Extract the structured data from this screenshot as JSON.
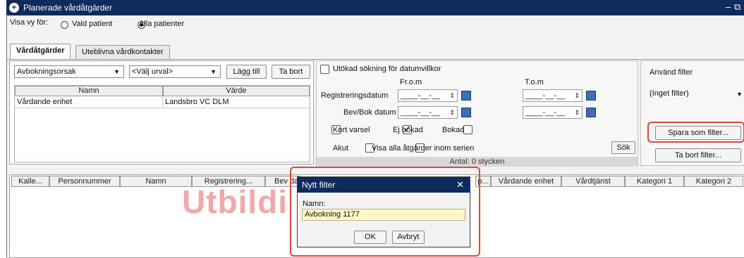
{
  "window": {
    "title": "Planerade vårdåtgärder",
    "minimize_glyph": "–",
    "restore_glyph": "⧉"
  },
  "show_for": {
    "label": "Visa vy för:",
    "options": [
      "Vald patient",
      "Alla patienter"
    ],
    "selected": "Alla patienter"
  },
  "tabs": [
    "Vårdåtgärder",
    "Uteblivna vårdkontakter"
  ],
  "criteria": {
    "reason_select": "Avbokningsorsak",
    "choice_select": "<Välj urval>",
    "add_button": "Lägg till",
    "remove_button": "Ta bort",
    "columns": [
      "Namn",
      "Värde"
    ],
    "rows": [
      {
        "name": "Vårdande enhet",
        "value": "Landsbro VC DLM"
      }
    ]
  },
  "dates": {
    "extended_search": "Utökad sökning för datumvillkor",
    "from_label": "Fr.o.m",
    "to_label": "T.o.m",
    "registration_label": "Registreringsdatum",
    "booking_label": "Bev/Bok datum",
    "date_placeholder": "____-__-__"
  },
  "flags": {
    "short_notice": "Kort varsel",
    "not_booked": "Ej bokad",
    "booked": "Bokad",
    "acute": "Akut",
    "show_all_series": "Visa alla åtgärder inom serien",
    "search_button": "Sök",
    "count": "Antal: 0 stycken"
  },
  "filter": {
    "label": "Använd filter",
    "selected": "(Inget filter)",
    "save_button": "Spara som filter...",
    "delete_button": "Ta bort filter..."
  },
  "results": {
    "columns": [
      "Kalle...",
      "Personnummer",
      "Namn",
      "Registrering...",
      "Bev da",
      "p...",
      "Vårdande enhet",
      "Vårdtjänst",
      "Kategori 1",
      "Kategori 2"
    ]
  },
  "watermark": "Utbildi",
  "dialog": {
    "title": "Nytt filter",
    "close_glyph": "✕",
    "name_label": "Namn:",
    "name_value": "Avbokning 1177",
    "ok_button": "OK",
    "cancel_button": "Avbryt"
  },
  "colors": {
    "titlebar": "#0f2a5c",
    "highlight": "#e0453f",
    "watermark": "#f2a8a8",
    "input_highlight": "#fff7c4"
  }
}
